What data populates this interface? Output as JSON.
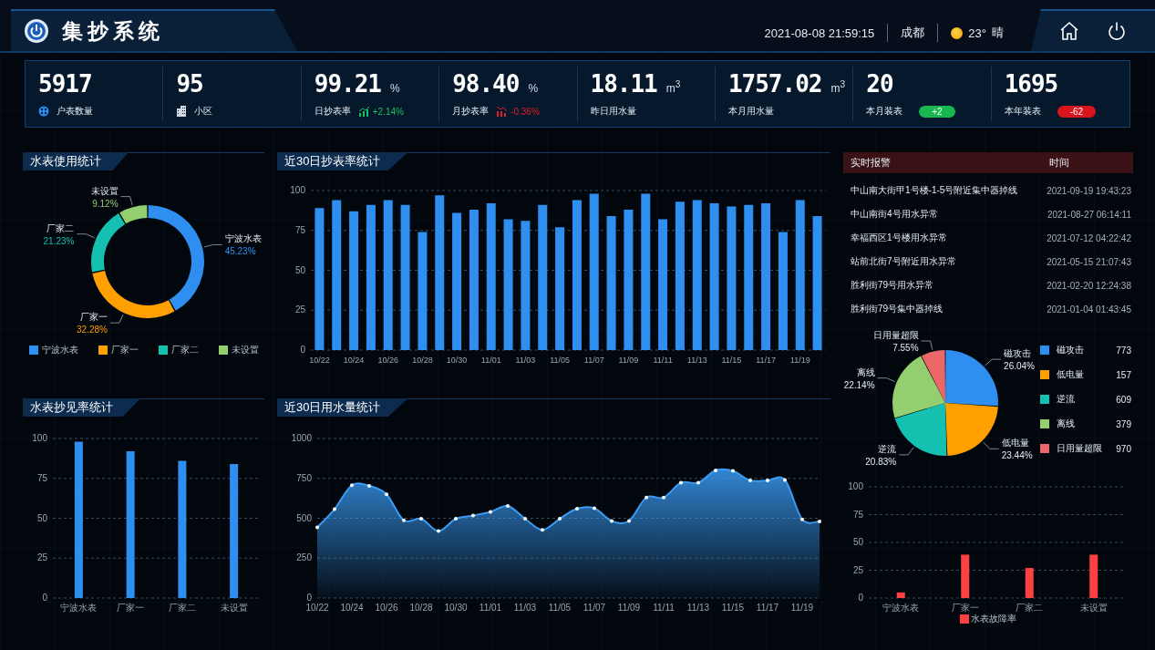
{
  "header": {
    "title": "集抄系统",
    "datetime": "2021-08-08 21:59:15",
    "city": "成都",
    "temperature": "23°",
    "weather": "晴"
  },
  "kpis": [
    {
      "kind": "icon",
      "value": "5917",
      "label": "户表数量"
    },
    {
      "kind": "icon",
      "value": "95",
      "label": "小区"
    },
    {
      "kind": "rise",
      "value": "99.21",
      "unit": "%",
      "label": "日抄表率",
      "change": "+2.14%"
    },
    {
      "kind": "fall",
      "value": "98.40",
      "unit": "%",
      "label": "月抄表率",
      "change": "-0.36%"
    },
    {
      "kind": "plain",
      "value": "18.11",
      "unit": "m$^{3}$",
      "label": "昨日用水量"
    },
    {
      "kind": "plain",
      "value": "1757.02",
      "unit": "m$^{3}$",
      "label": "本月用水量"
    },
    {
      "kind": "badge",
      "value": "20",
      "label": "本月装表",
      "badge": "+2",
      "color": "#18b850"
    },
    {
      "kind": "badge",
      "value": "1695",
      "label": "本年装表",
      "badge": "-62",
      "color": "#d8141c"
    }
  ],
  "usage": {
    "title": "水表使用统计",
    "chart_data": {
      "type": "donut",
      "categories": [
        "宁波水表",
        "厂家一",
        "厂家二",
        "未设置"
      ],
      "values": [
        45.23,
        32.28,
        21.23,
        9.12
      ],
      "value_labels": [
        "45.23%",
        "32.28%",
        "21.23%",
        "9.12%"
      ]
    },
    "legend": [
      {
        "label": "宁波水表",
        "color": "#2e8ff0"
      },
      {
        "label": "厂家一",
        "color": "#ff9f00"
      },
      {
        "label": "厂家二",
        "color": "#14c0b0"
      },
      {
        "label": "未设置",
        "color": "#93cf6e"
      }
    ]
  },
  "daily_rate": {
    "title": "近30日抄表率统计",
    "chart_data": {
      "type": "bar",
      "categories": [
        "10/22",
        null,
        "10/24",
        null,
        "10/26",
        null,
        "10/28",
        null,
        "10/30",
        null,
        "11/01",
        null,
        "11/03",
        null,
        "11/05",
        null,
        "11/07",
        null,
        "11/09",
        null,
        "11/11",
        null,
        "11/13",
        null,
        "11/15",
        null,
        "11/17",
        null,
        "11/19",
        null
      ],
      "ylim": [
        0,
        100
      ],
      "yticks": [
        0,
        25,
        50,
        75,
        100
      ],
      "grid": true,
      "series": [
        {
          "color": "#2e8ff0",
          "values": [
            89,
            94,
            87,
            91,
            94,
            91,
            74,
            97,
            86,
            88,
            92,
            82,
            81,
            91,
            77,
            94,
            98,
            84,
            88,
            98,
            82,
            93,
            94,
            92,
            90,
            91,
            92,
            74,
            94,
            84
          ]
        }
      ]
    }
  },
  "alarms": {
    "columns": [
      "实时报警",
      "时间"
    ],
    "rows": [
      [
        "中山南大街甲1号楼-1-5号附近集中器掉线",
        "2021-09-19 19:43:23"
      ],
      [
        "中山南街4号用水异常",
        "2021-08-27 06:14:11"
      ],
      [
        "幸福西区1号楼用水异常",
        "2021-07-12 04:22:42"
      ],
      [
        "站前北街7号附近用水异常",
        "2021-05-15 21:07:43"
      ],
      [
        "胜利街79号用水异常",
        "2021-02-20 12:24:38"
      ],
      [
        "胜利街79号集中器掉线",
        "2021-01-04 01:43:45"
      ]
    ]
  },
  "alarm_types": {
    "chart_data": {
      "type": "pie",
      "categories": [
        "磁攻击",
        "低电量",
        "逆流",
        "离线",
        "日用量超限"
      ],
      "values": [
        26.04,
        23.44,
        20.83,
        22.14,
        7.55
      ],
      "value_labels": [
        "26.04%",
        "23.44%",
        "20.83%",
        "22.14%",
        "7.55%"
      ]
    },
    "legend": [
      {
        "label": "磁攻击",
        "value": "773",
        "color": "#2e8ff0"
      },
      {
        "label": "低电量",
        "value": "157",
        "color": "#ff9f00"
      },
      {
        "label": "逆流",
        "value": "609",
        "color": "#14c0b0"
      },
      {
        "label": "离线",
        "value": "379",
        "color": "#93cf6e"
      },
      {
        "label": "日用量超限",
        "value": "970",
        "color": "#ec6868"
      }
    ]
  },
  "read_rate": {
    "title": "水表抄见率统计",
    "chart_data": {
      "type": "bar",
      "categories": [
        "宁波水表",
        "厂家一",
        "厂家二",
        "未设置"
      ],
      "ylim": [
        0,
        100
      ],
      "yticks": [
        0,
        25,
        50,
        75,
        100
      ],
      "grid": true,
      "series": [
        {
          "color": "#2e8ff0",
          "values": [
            98,
            92,
            86,
            84
          ]
        }
      ]
    }
  },
  "daily_usage": {
    "title": "近30日用水量统计",
    "chart_data": {
      "type": "area",
      "categories": [
        "10/22",
        null,
        "10/24",
        null,
        "10/26",
        null,
        "10/28",
        null,
        "10/30",
        null,
        "11/01",
        null,
        "11/03",
        null,
        "11/05",
        null,
        "11/07",
        null,
        "11/09",
        null,
        "11/11",
        null,
        "11/13",
        null,
        "11/15",
        null,
        "11/17",
        null,
        "11/19",
        null
      ],
      "ylim": [
        0,
        1000
      ],
      "yticks": [
        0,
        250,
        500,
        750,
        1000
      ],
      "grid": true,
      "series": [
        {
          "color": "#3a9cf5",
          "values": [
            443,
            557,
            707,
            703,
            650,
            487,
            497,
            420,
            497,
            517,
            540,
            577,
            497,
            427,
            497,
            560,
            563,
            483,
            483,
            630,
            630,
            723,
            723,
            800,
            797,
            737,
            737,
            740,
            493,
            480
          ]
        }
      ]
    }
  },
  "fault_rate": {
    "chart_data": {
      "type": "bar",
      "categories": [
        "宁波水表",
        "厂家一",
        "厂家二",
        "未设置"
      ],
      "ylim": [
        0,
        100
      ],
      "yticks": [
        0,
        25,
        50,
        75,
        100
      ],
      "grid": true,
      "series": [
        {
          "name": "水表故障率",
          "color": "#ff4040",
          "values": [
            5,
            39,
            27,
            39
          ]
        }
      ]
    }
  }
}
